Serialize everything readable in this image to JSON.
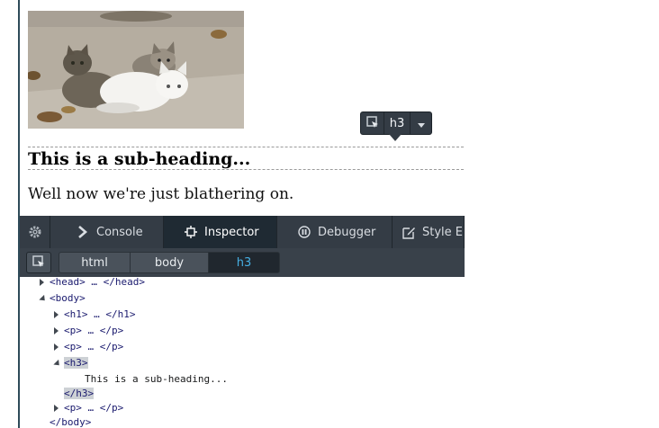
{
  "page": {
    "image_alt": "kittens photo",
    "sub_heading": "This is a sub-heading...",
    "paragraph": "Well now we're just blathering on."
  },
  "infobar": {
    "tag": "h3"
  },
  "devtools": {
    "tabs": [
      {
        "label": "",
        "icon": "gear-icon"
      },
      {
        "label": "Console",
        "icon": "chevron-right-icon"
      },
      {
        "label": "Inspector",
        "icon": "inspector-icon",
        "selected": true
      },
      {
        "label": "Debugger",
        "icon": "pause-circle-icon"
      },
      {
        "label": "Style E",
        "icon": "edit-icon"
      }
    ],
    "breadcrumbs": [
      "html",
      "body",
      "h3"
    ]
  },
  "tree": {
    "head": "<head> … </head>",
    "body_open": "<body>",
    "h1": "<h1> … </h1>",
    "p1": "<p> … </p>",
    "p2": "<p> … </p>",
    "h3_open": "<h3>",
    "h3_text": "This is a sub-heading...",
    "h3_close": "</h3>",
    "p3": "<p> … </p>",
    "body_close": "</body>"
  },
  "colors": {
    "toolbar_bg": "#343c45",
    "selected_crumb_text": "#46afe3",
    "rule": "#2f4b59"
  }
}
